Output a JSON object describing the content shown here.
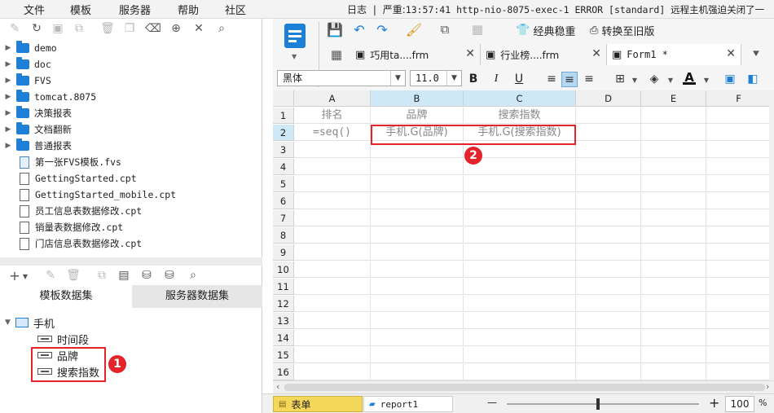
{
  "menu": [
    "文件",
    "模板",
    "服务器",
    "帮助",
    "社区"
  ],
  "log": {
    "label": "日志",
    "separator": "|",
    "level": "严重:",
    "message": "13:57:41 http-nio-8075-exec-1 ERROR [standard] 远程主机强迫关闭了一"
  },
  "file_tree": [
    {
      "label": "demo",
      "kind": "folder"
    },
    {
      "label": "doc",
      "kind": "folder"
    },
    {
      "label": "FVS",
      "kind": "folder"
    },
    {
      "label": "tomcat.8075",
      "kind": "folder"
    },
    {
      "label": "决策报表",
      "kind": "folder"
    },
    {
      "label": "文档翻新",
      "kind": "folder"
    },
    {
      "label": "普通报表",
      "kind": "folder"
    },
    {
      "label": "第一张FVS模板.fvs",
      "kind": "fvs"
    },
    {
      "label": "GettingStarted.cpt",
      "kind": "file"
    },
    {
      "label": "GettingStarted_mobile.cpt",
      "kind": "file"
    },
    {
      "label": "员工信息表数据修改.cpt",
      "kind": "file"
    },
    {
      "label": "销量表数据修改.cpt",
      "kind": "file"
    },
    {
      "label": "门店信息表数据修改.cpt",
      "kind": "file"
    }
  ],
  "dataset_tabs": [
    "模板数据集",
    "服务器数据集"
  ],
  "dataset": {
    "name": "手机",
    "fields": [
      "时间段",
      "品牌",
      "搜索指数"
    ]
  },
  "toolbar": {
    "classic_label": "经典稳重",
    "convert_label": "转换至旧版"
  },
  "doc_tabs": [
    {
      "label": "巧用ta....frm"
    },
    {
      "label": "行业榜....frm"
    },
    {
      "label": "Form1 *"
    }
  ],
  "format": {
    "font": "黑体",
    "size": "11.0",
    "bold": "B",
    "italic": "I",
    "underline": "U",
    "font_color": "A"
  },
  "sheet": {
    "columns": [
      "A",
      "B",
      "C",
      "D",
      "E",
      "F"
    ],
    "rows": [
      "1",
      "2",
      "3",
      "4",
      "5",
      "6",
      "7",
      "8",
      "9",
      "10",
      "11",
      "12",
      "13",
      "14",
      "15",
      "16"
    ],
    "cells": {
      "A1": "排名",
      "B1": "品牌",
      "C1": "搜索指数",
      "A2": "=seq()",
      "B2": "手机.G(品牌)",
      "C2": "手机.G(搜索指数)"
    }
  },
  "annotations": {
    "badge1": "1",
    "badge2": "2"
  },
  "sheet_tabs": [
    "表单",
    "report1"
  ],
  "zoom": {
    "minus": "—",
    "plus": "+",
    "value": "100",
    "unit": "%"
  },
  "colors": {
    "accent": "#1e7fd6",
    "highlight": "#e4232a",
    "selected_header": "#cfe8f6"
  }
}
